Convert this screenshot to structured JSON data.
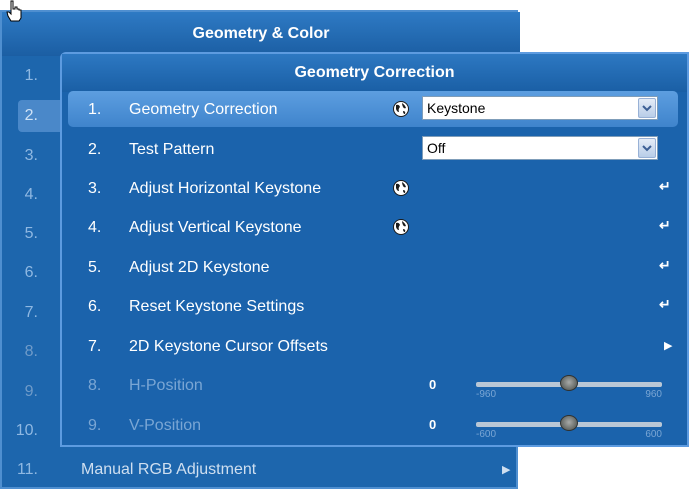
{
  "back_menu": {
    "title": "Geometry & Color",
    "rows": [
      {
        "num": "1.",
        "label": ""
      },
      {
        "num": "2.",
        "label": ""
      },
      {
        "num": "3.",
        "label": ""
      },
      {
        "num": "4.",
        "label": ""
      },
      {
        "num": "5.",
        "label": ""
      },
      {
        "num": "6.",
        "label": ""
      },
      {
        "num": "7.",
        "label": ""
      },
      {
        "num": "8.",
        "label": ""
      },
      {
        "num": "9.",
        "label": ""
      },
      {
        "num": "10.",
        "label": ""
      },
      {
        "num": "11.",
        "label": "Manual RGB Adjustment"
      }
    ]
  },
  "front_menu": {
    "title": "Geometry Correction",
    "rows": [
      {
        "num": "1.",
        "label": "Geometry Correction",
        "control": "Keystone"
      },
      {
        "num": "2.",
        "label": "Test Pattern",
        "control": "Off"
      },
      {
        "num": "3.",
        "label": "Adjust Horizontal Keystone"
      },
      {
        "num": "4.",
        "label": "Adjust Vertical Keystone"
      },
      {
        "num": "5.",
        "label": "Adjust 2D Keystone"
      },
      {
        "num": "6.",
        "label": "Reset Keystone Settings"
      },
      {
        "num": "7.",
        "label": "2D Keystone Cursor Offsets"
      },
      {
        "num": "8.",
        "label": "H-Position",
        "value": "0",
        "min": "-960",
        "max": "960",
        "level": 0.5
      },
      {
        "num": "9.",
        "label": "V-Position",
        "value": "0",
        "min": "-600",
        "max": "600",
        "level": 0.5
      }
    ]
  },
  "icons": {
    "globe": "globe-icon",
    "enter": "enter-arrow-icon",
    "submenu": "submenu-triangle-icon",
    "dropdown": "chevron-down-icon",
    "cursor": "hand-pointer-icon"
  },
  "colors": {
    "panel": "#1d66ad",
    "selected": "#4a8fd4",
    "disabled_text": "#7aa6d4"
  }
}
